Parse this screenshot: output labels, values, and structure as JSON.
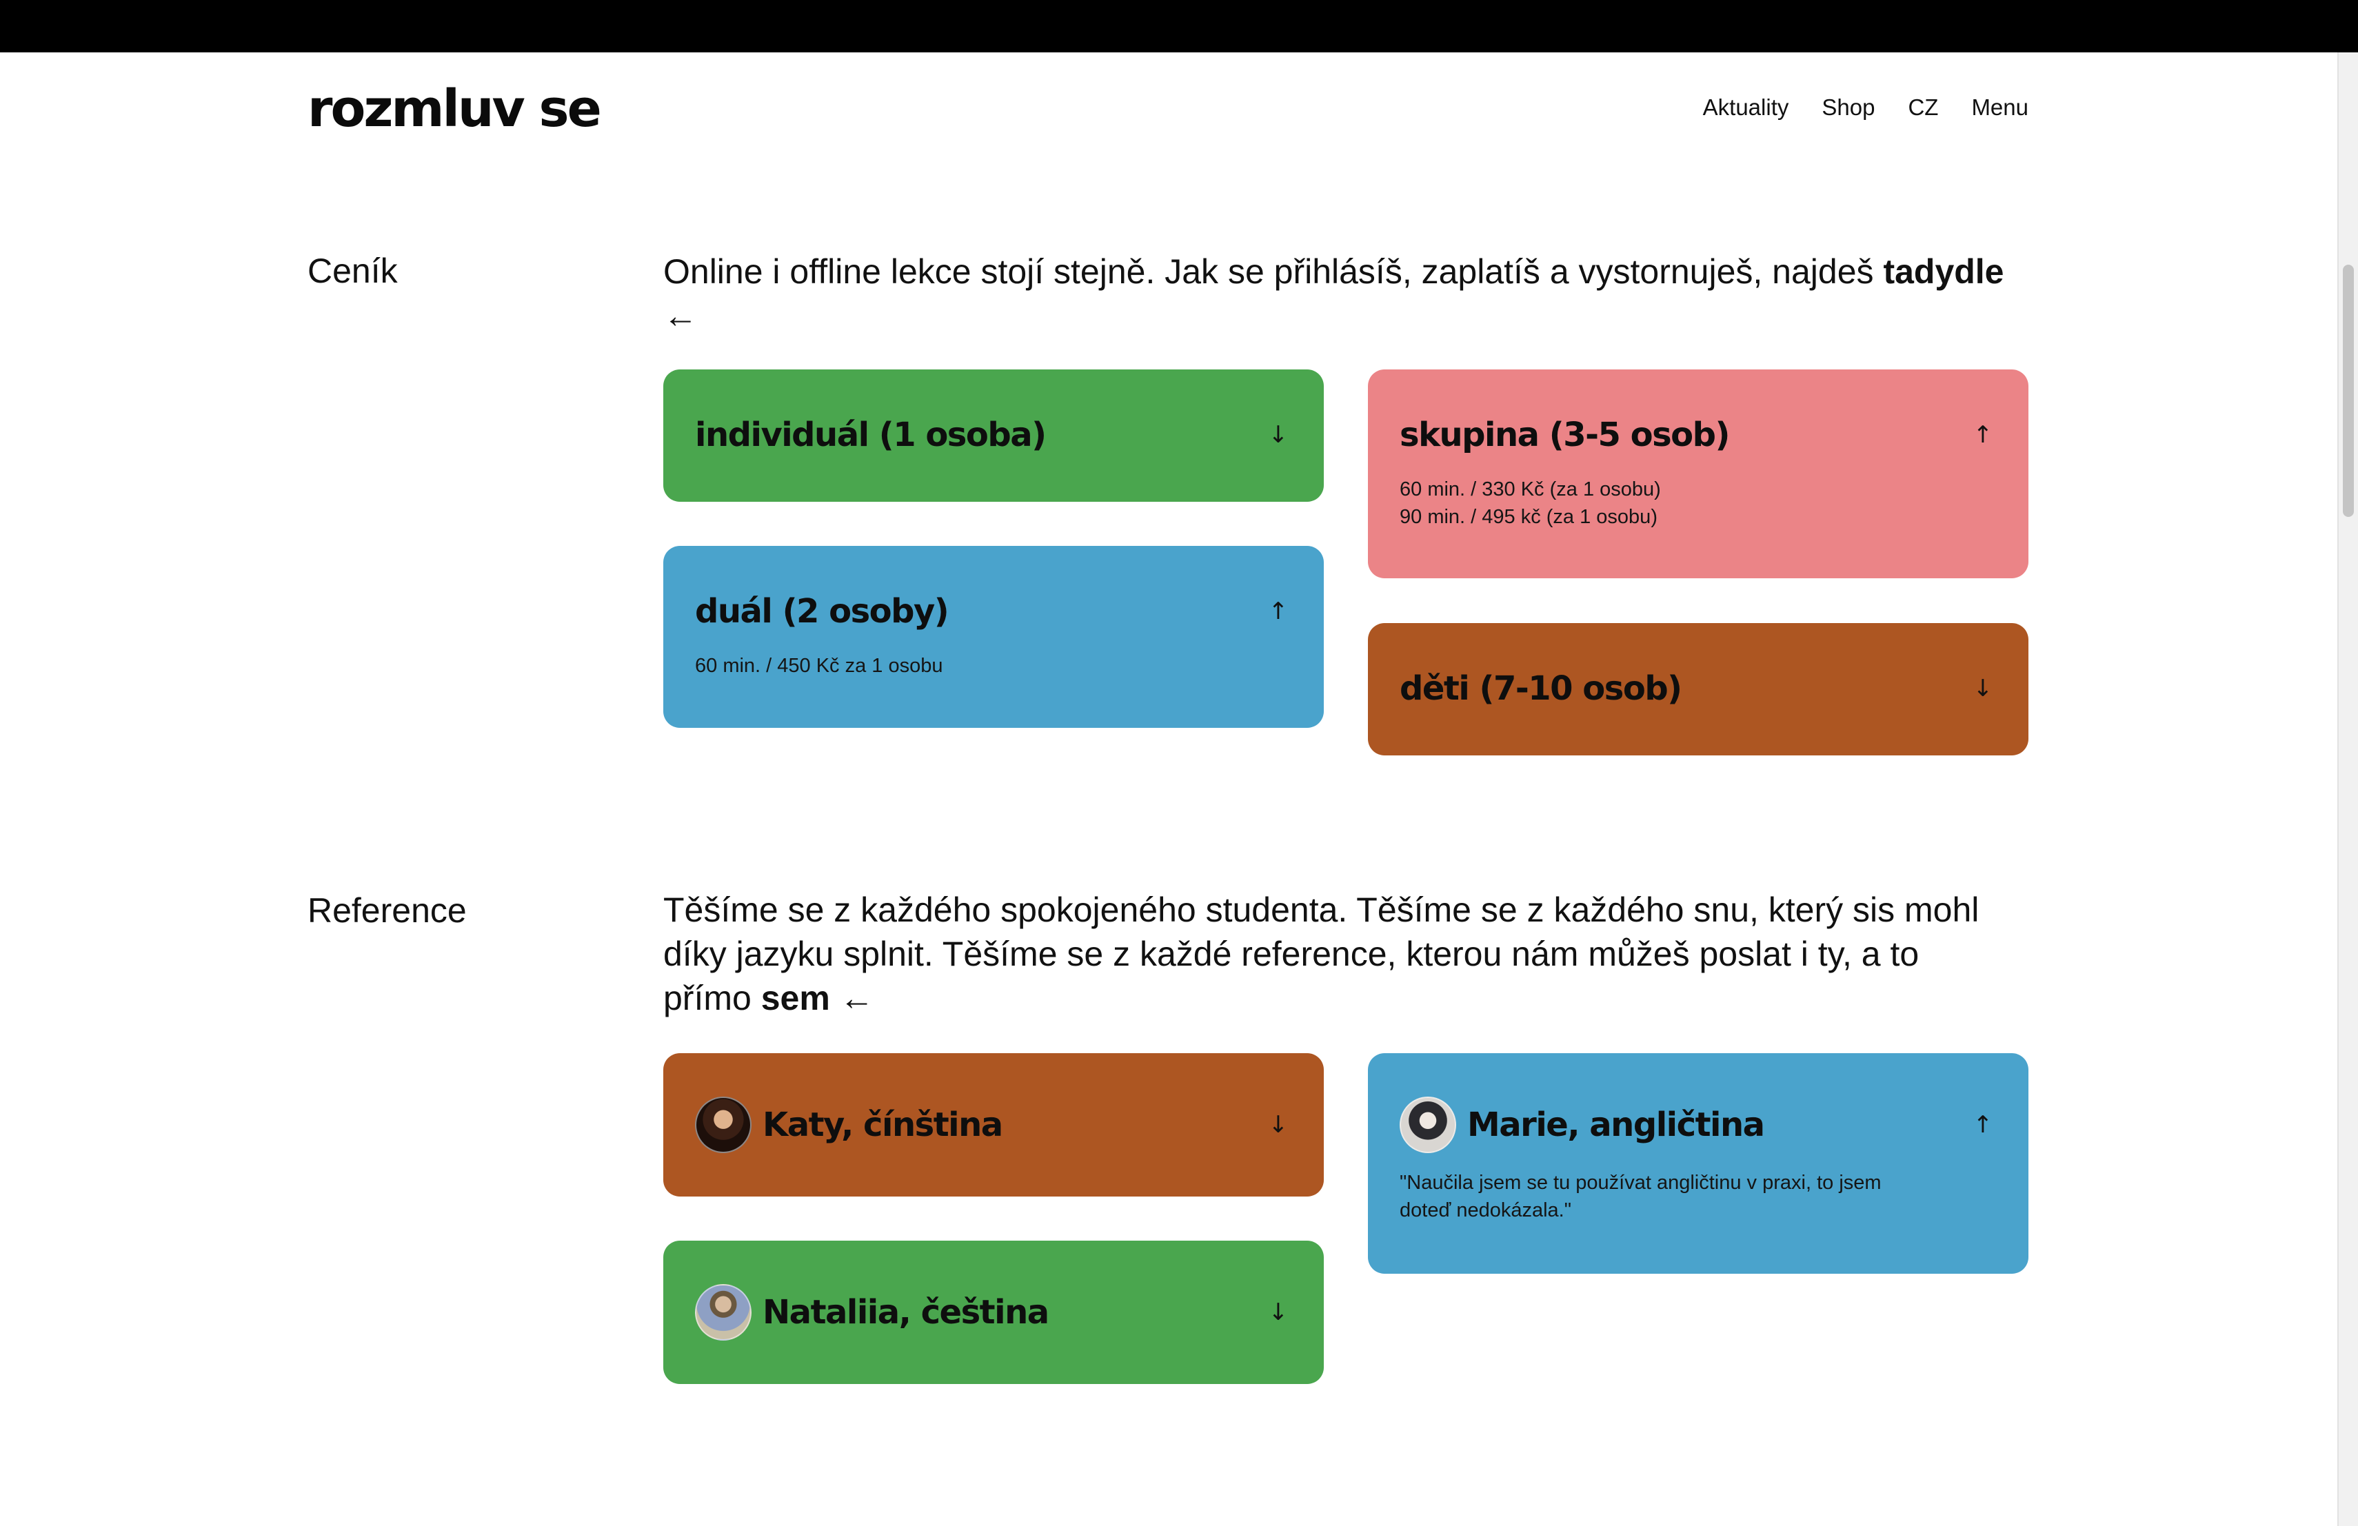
{
  "header": {
    "logo": "rozmluv se",
    "nav": [
      "Aktuality",
      "Shop",
      "CZ",
      "Menu"
    ]
  },
  "pricing": {
    "label": "Ceník",
    "intro": "Online i offline lekce stojí stejně. Jak se přihlásíš, zaplatíš a vystornuješ, najdeš",
    "intro_link": "tadydle",
    "intro_arrow": "←",
    "cards": [
      {
        "title": "individuál (1 osoba)",
        "color": "#4aa64e",
        "state": "collapsed",
        "arrow": "↓",
        "lines": []
      },
      {
        "title": "duál (2 osoby)",
        "color": "#4aa3cc",
        "state": "expanded",
        "arrow": "↑",
        "lines": [
          "60 min. / 450 Kč za 1 osobu"
        ]
      },
      {
        "title": "skupina (3-5 osob)",
        "color": "#eb8487",
        "state": "expanded",
        "arrow": "↑",
        "lines": [
          "60 min. / 330 Kč (za 1 osobu)",
          "90 min. / 495 kč (za 1 osobu)"
        ]
      },
      {
        "title": "děti (7-10 osob)",
        "color": "#ad5622",
        "state": "collapsed",
        "arrow": "↓",
        "lines": []
      }
    ]
  },
  "references": {
    "label": "Reference",
    "intro": "Těšíme se z každého spokojeného studenta. Těšíme se z každého snu, který sis mohl díky jazyku splnit. Těšíme se z každé reference, kterou nám můžeš poslat i ty, a to přímo",
    "intro_link": "sem",
    "intro_arrow": "←",
    "cards": [
      {
        "title": "Katy, čínština",
        "color": "#ad5622",
        "state": "collapsed",
        "arrow": "↓",
        "quote": ""
      },
      {
        "title": "Nataliia, čeština",
        "color": "#4aa64e",
        "state": "collapsed",
        "arrow": "↓",
        "quote": ""
      },
      {
        "title": "Marie, angličtina",
        "color": "#4aa3cc",
        "state": "expanded",
        "arrow": "↑",
        "quote": "\"Naučila jsem se tu používat angličtinu v praxi, to jsem doteď nedokázala.\""
      }
    ]
  }
}
